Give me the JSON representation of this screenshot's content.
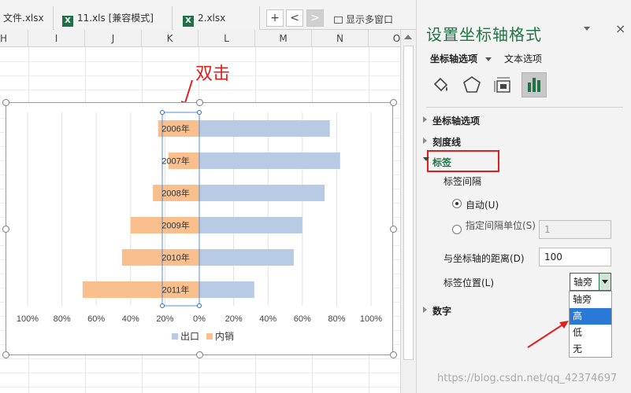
{
  "tabs": [
    {
      "label": "文件.xlsx",
      "icon": "excel-file-icon"
    },
    {
      "label": "11.xls  [兼容模式]",
      "icon": "excel-file-icon"
    },
    {
      "label": "2.xlsx",
      "icon": "excel-file-icon"
    }
  ],
  "tabbar": {
    "new_tab": "+",
    "prev": "<",
    "next": ">",
    "multi_window": "显示多窗口"
  },
  "columns": [
    "H",
    "I",
    "J",
    "K",
    "L",
    "M",
    "N",
    "O"
  ],
  "annotation": {
    "text": "双击",
    "color": "#e02020"
  },
  "chart_data": {
    "type": "bar",
    "orientation": "horizontal",
    "categories": [
      "2006年",
      "2007年",
      "2008年",
      "2009年",
      "2010年",
      "2011年"
    ],
    "series": [
      {
        "name": "出口",
        "values": [
          0.76,
          0.82,
          0.73,
          0.6,
          0.55,
          0.32
        ],
        "color": "#b7cbe4"
      },
      {
        "name": "内销",
        "values": [
          -0.24,
          -0.18,
          -0.27,
          -0.4,
          -0.45,
          -0.68
        ],
        "color": "#f9c08e"
      }
    ],
    "x_ticks": [
      "100%",
      "80%",
      "60%",
      "40%",
      "20%",
      "0%",
      "20%",
      "40%",
      "60%",
      "80%",
      "100%"
    ],
    "xlim": [
      -1,
      1
    ],
    "legend": "bottom",
    "grid": true
  },
  "panel": {
    "title": "设置坐标轴格式",
    "tab_axis_options": "坐标轴选项",
    "tab_text_options": "文本选项",
    "sections": {
      "axis_options": "坐标轴选项",
      "tick_marks": "刻度线",
      "labels": "标签",
      "number": "数字"
    },
    "label_interval": "标签间隔",
    "radio_auto": "自动(U)",
    "radio_specify": "指定间隔单位(S)",
    "interval_value": "1",
    "distance_label": "与坐标轴的距离(D)",
    "distance_value": "100",
    "position_label": "标签位置(L)",
    "position_value": "轴旁",
    "options": [
      "轴旁",
      "高",
      "低",
      "无"
    ]
  },
  "watermark": "https://blog.csdn.net/qq_42374697"
}
